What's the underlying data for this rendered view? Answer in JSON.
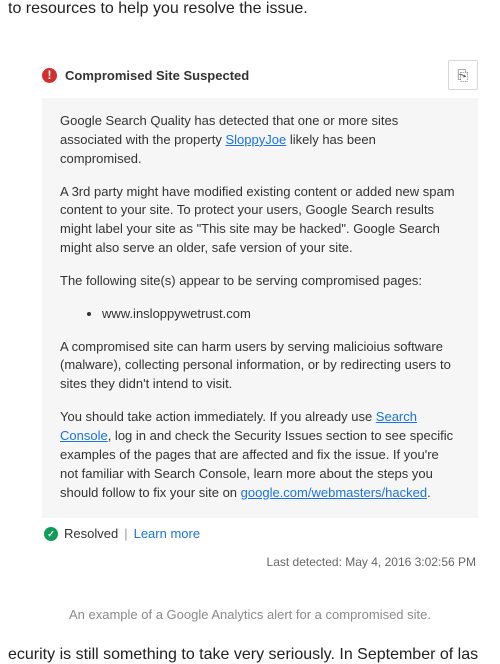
{
  "fragments": {
    "top": "to resources to help you resolve the issue.",
    "bottom": "ecurity is still something to take very seriously. In September of las"
  },
  "alert": {
    "title": "Compromised Site Suspected",
    "para1_a": "Google Search Quality has detected that one or more sites associated with the property ",
    "property_name": "SloppyJoe",
    "para1_b": " likely has been compromised.",
    "para2": "A 3rd party might have modified existing content or added new spam content to your site. To protect your users, Google Search results might label your site as \"This site may be hacked\". Google Search might also serve an older, safe version of your site.",
    "para3": "The following site(s) appear to be serving compromised pages:",
    "sites": [
      "www.insloppywetrust.com"
    ],
    "para4": "A compromised site can harm users by serving malicioius software (malware), collecting personal information, or by redirecting users to sites they didn't intend to visit.",
    "para5_a": "You should take action immediately. If you already use ",
    "link_search_console": "Search Console",
    "para5_b": ", log in and check the Security Issues section to see specific examples of the pages that are affected and fix the issue. If you're not familiar with Search Console, learn more about the steps you should follow to fix your site on ",
    "link_hacked": "google.com/webmasters/hacked",
    "para5_c": "."
  },
  "status": {
    "resolved": "Resolved",
    "pipe": "|",
    "learn_more": "Learn more",
    "detected_label": "Last detected:",
    "detected_value": "May 4, 2016 3:02:56 PM"
  },
  "caption": "An example of a Google Analytics alert for a compromised site.",
  "icons": {
    "warn_glyph": "!",
    "check_glyph": "✓",
    "copy_glyph": "⎘"
  }
}
